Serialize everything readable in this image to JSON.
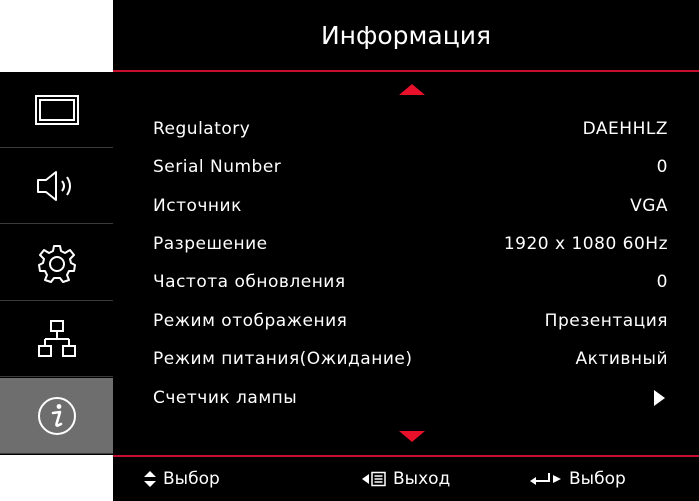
{
  "menu": {
    "title": "Информация",
    "tabs": [
      {
        "name": "display-icon"
      },
      {
        "name": "audio-icon"
      },
      {
        "name": "settings-gear-icon"
      },
      {
        "name": "network-icon"
      },
      {
        "name": "info-icon",
        "active": true
      }
    ],
    "rows": [
      {
        "label": "Regulatory",
        "value": "DAEHHLZ"
      },
      {
        "label": "Serial Number",
        "value": "0"
      },
      {
        "label": "Источник",
        "value": "VGA"
      },
      {
        "label": "Разрешение",
        "value": "1920 x 1080 60Hz"
      },
      {
        "label": "Частота обновления",
        "value": "0"
      },
      {
        "label": "Режим отображения",
        "value": "Презентация"
      },
      {
        "label": "Режим питания(Ожидание)",
        "value": "Активный"
      },
      {
        "label": "Счетчик лампы",
        "value": ""
      }
    ]
  },
  "footer": {
    "select_label": "Выбор",
    "exit_label": "Выход",
    "enter_select_label": "Выбор"
  },
  "colors": {
    "accent": "#e8102b",
    "background": "#000000",
    "active_tab": "#6e6e6e"
  }
}
